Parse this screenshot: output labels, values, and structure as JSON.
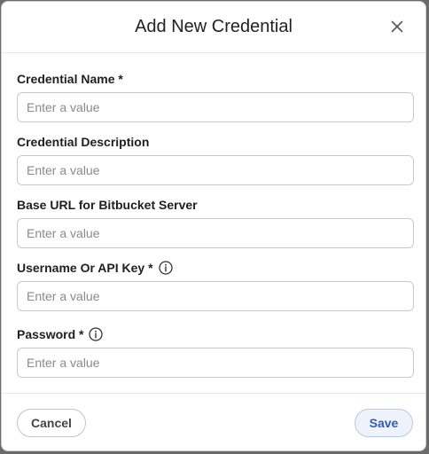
{
  "dialog": {
    "title": "Add New Credential",
    "close_icon": "close-icon"
  },
  "fields": [
    {
      "label": "Credential Name *",
      "placeholder": "Enter a value",
      "value": "",
      "info": false
    },
    {
      "label": "Credential Description",
      "placeholder": "Enter a value",
      "value": "",
      "info": false
    },
    {
      "label": "Base URL for Bitbucket Server",
      "placeholder": "Enter a value",
      "value": "",
      "info": false
    },
    {
      "label": "Username Or API Key *",
      "placeholder": "Enter a value",
      "value": "",
      "info": true,
      "info_icon": "info-icon"
    },
    {
      "label": "Password *",
      "placeholder": "Enter a value",
      "value": "",
      "info": true,
      "info_icon": "info-icon"
    }
  ],
  "footer": {
    "cancel_label": "Cancel",
    "save_label": "Save"
  },
  "colors": {
    "accent": "#2f5bb7",
    "save_bg": "#eef3fb",
    "border": "#c9c9c9"
  }
}
